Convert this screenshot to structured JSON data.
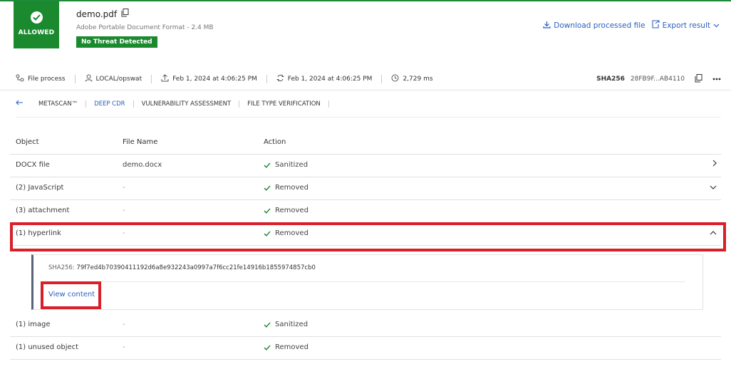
{
  "status": {
    "label": "ALLOWED",
    "color": "#1b8a2f"
  },
  "file": {
    "name": "demo.pdf",
    "type": "Adobe Portable Document Format - 2.4 MB",
    "threat_label": "No Threat Detected"
  },
  "header_actions": {
    "download_label": "Download processed file",
    "export_label": "Export result"
  },
  "info": {
    "process_label": "File process",
    "user": "LOCAL/opswat",
    "uploaded": "Feb 1, 2024 at 4:06:25 PM",
    "processed": "Feb 1, 2024 at 4:06:25 PM",
    "duration": "2,729 ms",
    "sha_label": "SHA256",
    "sha_value": "28FB9F...AB4110"
  },
  "tabs": [
    {
      "label": "METASCAN™"
    },
    {
      "label": "DEEP CDR",
      "active": true
    },
    {
      "label": "VULNERABILITY ASSESSMENT"
    },
    {
      "label": "FILE TYPE VERIFICATION"
    }
  ],
  "table": {
    "headers": [
      "Object",
      "File Name",
      "Action"
    ],
    "rows": [
      {
        "object": "DOCX file",
        "file_name": "demo.docx",
        "action": "Sanitized",
        "chevron": "right"
      },
      {
        "object": "(2)  JavaScript",
        "file_name": "-",
        "action": "Removed",
        "chevron": "down"
      },
      {
        "object": "(3)  attachment",
        "file_name": "-",
        "action": "Removed",
        "chevron": ""
      },
      {
        "object": "(1)  hyperlink",
        "file_name": "-",
        "action": "Removed",
        "chevron": "up"
      },
      {
        "object": "(1)  image",
        "file_name": "-",
        "action": "Sanitized",
        "chevron": ""
      },
      {
        "object": "(1)  unused object",
        "file_name": "-",
        "action": "Removed",
        "chevron": ""
      }
    ]
  },
  "detail": {
    "sha_label": "SHA256:",
    "sha_value": "79f7ed4b70390411192d6a8e932243a0997a7f6cc21fe14916b1855974857cb0",
    "view_label": "View content"
  },
  "colors": {
    "accent": "#2a5fbf",
    "success": "#1b8a2f",
    "highlight": "#d81f2a"
  }
}
